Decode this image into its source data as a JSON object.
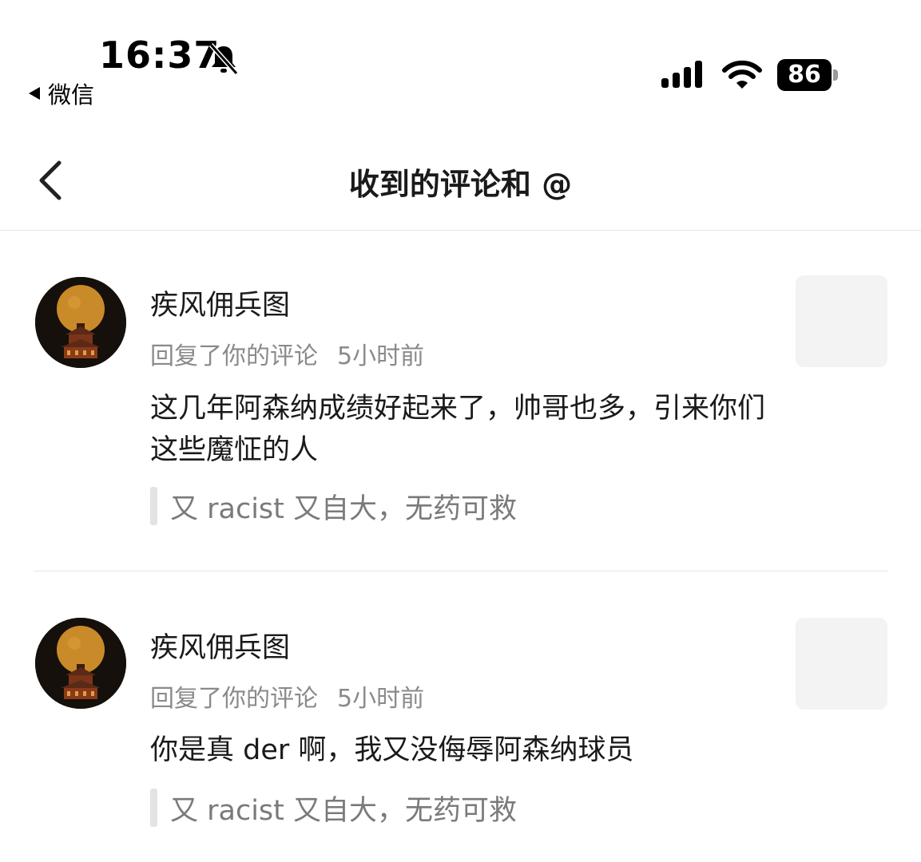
{
  "status_bar": {
    "time": "16:37",
    "back_app": "微信",
    "battery": "86",
    "icons": [
      "bell-muted-icon",
      "signal-icon",
      "wifi-icon",
      "battery-icon"
    ]
  },
  "nav": {
    "title": "收到的评论和 @",
    "back_icon": "chevron-left-icon"
  },
  "items": [
    {
      "username": "疾风佣兵图",
      "action": "回复了你的评论",
      "time": "5小时前",
      "text": "这几年阿森纳成绩好起来了，帅哥也多，引来你们这些魔怔的人",
      "quote": "又 racist 又自大，无药可救"
    },
    {
      "username": "疾风佣兵图",
      "action": "回复了你的评论",
      "time": "5小时前",
      "text": "你是真 der 啊，我又没侮辱阿森纳球员",
      "quote": "又 racist 又自大，无药可救"
    }
  ]
}
